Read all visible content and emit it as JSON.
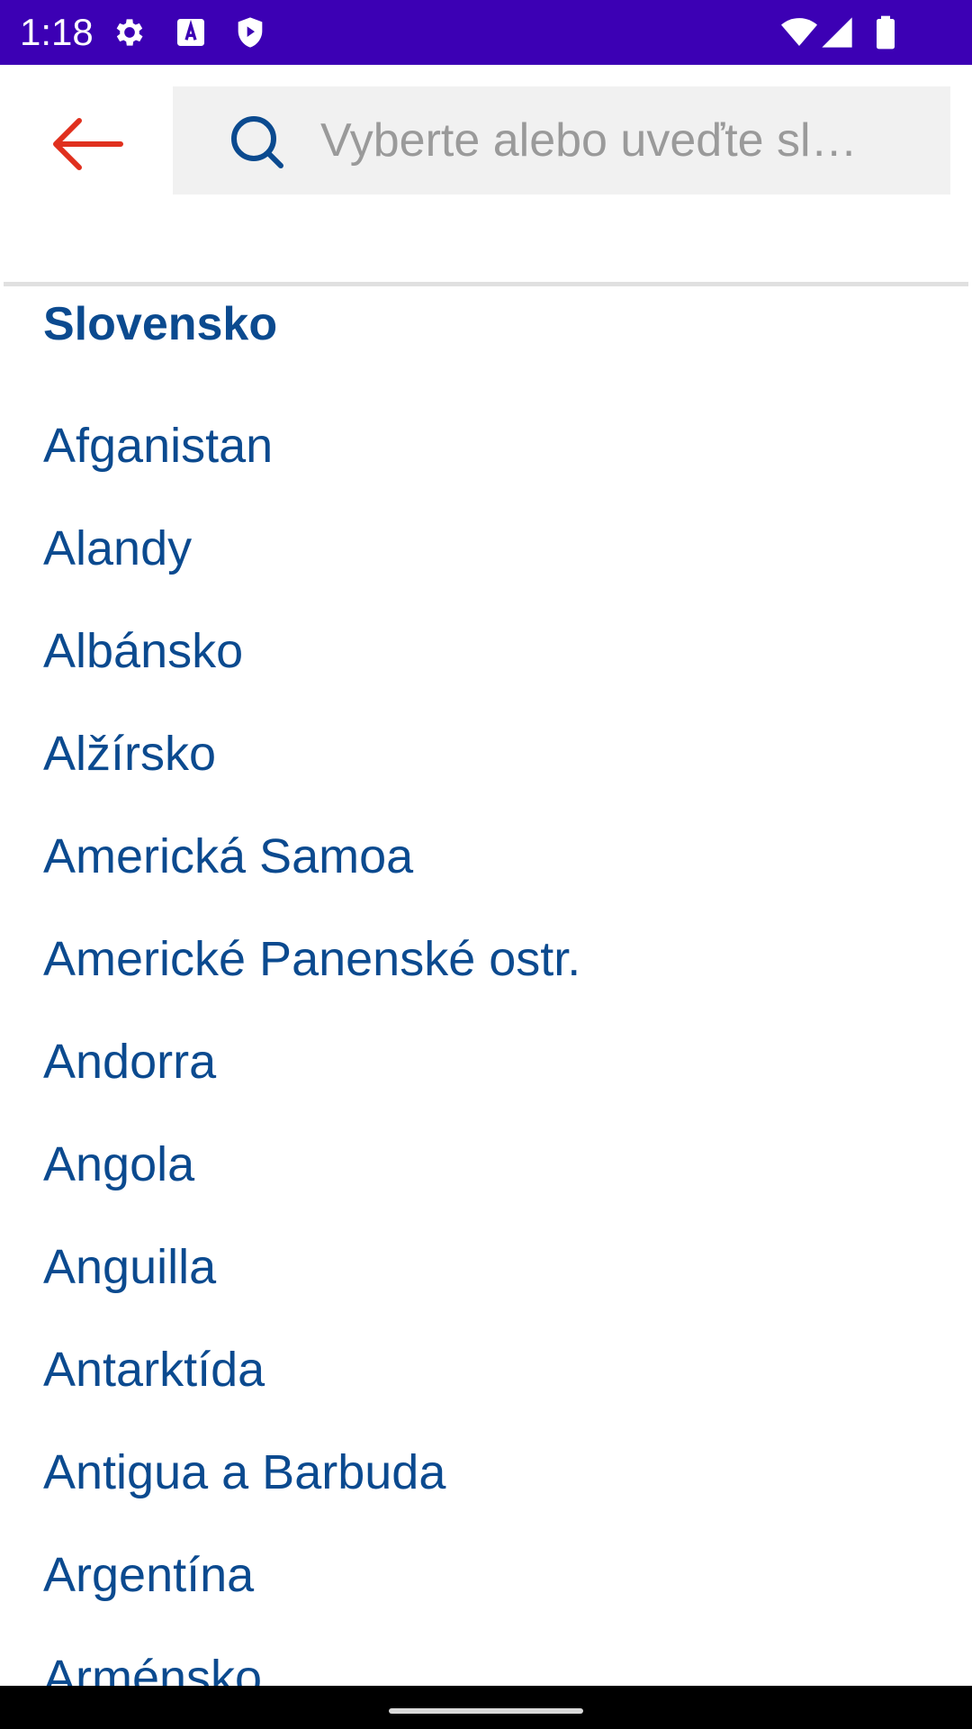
{
  "status_bar": {
    "time": "1:18",
    "background_color": "#3c00b4",
    "left_icons": [
      "settings-icon",
      "keyboard-a-icon",
      "play-protect-icon"
    ],
    "right_icons": [
      "wifi-icon",
      "signal-icon",
      "battery-icon"
    ]
  },
  "header": {
    "back_icon": "arrow-left-icon",
    "back_color": "#e0301e",
    "search": {
      "placeholder": "Vyberte alebo uveďte sl…",
      "value": "",
      "icon": "search-icon",
      "icon_color": "#0b4a8f"
    }
  },
  "list": {
    "selected": "Slovensko",
    "text_color": "#0b4a8f",
    "items": [
      "Afganistan",
      "Alandy",
      "Albánsko",
      "Alžírsko",
      "Americká Samoa",
      "Americké Panenské ostr.",
      "Andorra",
      "Angola",
      "Anguilla",
      "Antarktída",
      "Antigua a Barbuda",
      "Argentína",
      "Arménsko"
    ]
  }
}
